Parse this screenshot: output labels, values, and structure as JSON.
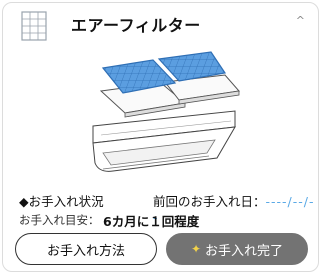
{
  "panel": {
    "title": "エアーフィルター",
    "collapse_icon": "chevron-up-icon"
  },
  "status": {
    "label": "◆お手入れ状況",
    "last_cleaned_label": "前回のお手入れ日：",
    "last_cleaned_value": "----/--/--",
    "guideline_label": "お手入れ目安：",
    "guideline_value": "6カ月に１回程度"
  },
  "buttons": {
    "method_label": "お手入れ方法",
    "done_label": "お手入れ完了",
    "done_icon": "sparkle-icon"
  },
  "colors": {
    "filter_blue": "#4a90d9",
    "date_accent": "#5aa9e6",
    "done_button_bg": "#737373"
  }
}
